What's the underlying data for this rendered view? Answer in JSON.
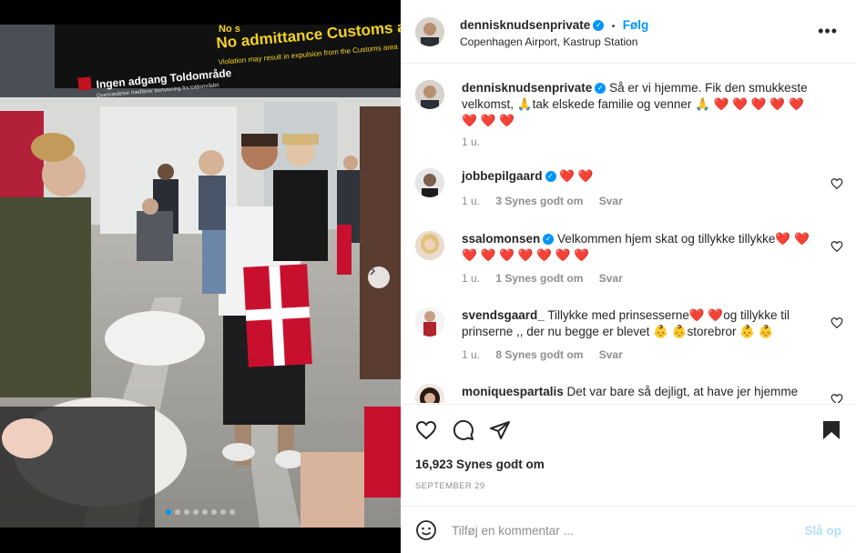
{
  "post": {
    "username": "dennisknudsenprivate",
    "follow_label": "Følg",
    "separator": "•",
    "location": "Copenhagen Airport, Kastrup Station",
    "more_label": "•••",
    "caption": "Så er vi hjemme. Fik den smukkeste velkomst, 🙏tak elskede familie og venner 🙏 ❤️ ❤️ ❤️ ❤️ ❤️ ❤️ ❤️ ❤️",
    "caption_time": "1 u.",
    "likes": "16,923 Synes godt om",
    "date": "SEPTEMBER 29"
  },
  "photo_signs": {
    "top_sign": "No admittance Customs area",
    "top_sign_sub": "Violation may result in expulsion from the Customs area",
    "left_sign": "Ingen adgang Toldområde",
    "left_sign_sub": "Overtrædelse medfører bortvisning fra toldområdet",
    "no_tag": "No s"
  },
  "carousel": {
    "count": 8,
    "active": 0
  },
  "comments": [
    {
      "username": "jobbepilgaard",
      "verified": true,
      "text": "❤️ ❤️",
      "time": "1 u.",
      "likes": "3 Synes godt om",
      "reply": "Svar"
    },
    {
      "username": "ssalomonsen",
      "verified": true,
      "text": "Velkommen hjem skat og tillykke tillykke❤️ ❤️ ❤️ ❤️ ❤️ ❤️ ❤️ ❤️ ❤️",
      "time": "1 u.",
      "likes": "1 Synes godt om",
      "reply": "Svar"
    },
    {
      "username": "svendsgaard_",
      "verified": false,
      "text": "Tillykke med prinsesserne❤️ ❤️og tillykke til prinserne ,, der nu begge er blevet 👶 👶storebror 👶 👶",
      "time": "1 u.",
      "likes": "8 Synes godt om",
      "reply": "Svar"
    },
    {
      "username": "moniquespartalis",
      "verified": false,
      "text": "Det var bare så dejligt, at have jer hjemme",
      "time": "",
      "likes": "",
      "reply": ""
    }
  ],
  "add_comment": {
    "placeholder": "Tilføj en kommentar ...",
    "post_label": "Slå op"
  },
  "icons": {
    "like": "heart-icon",
    "comment": "comment-icon",
    "share": "send-icon",
    "save": "bookmark-icon",
    "emoji": "emoji-icon",
    "verified": "verified-badge-icon"
  },
  "colors": {
    "accent": "#0095f6",
    "post_disabled": "#b2dffc",
    "heart": "#e0112b"
  }
}
